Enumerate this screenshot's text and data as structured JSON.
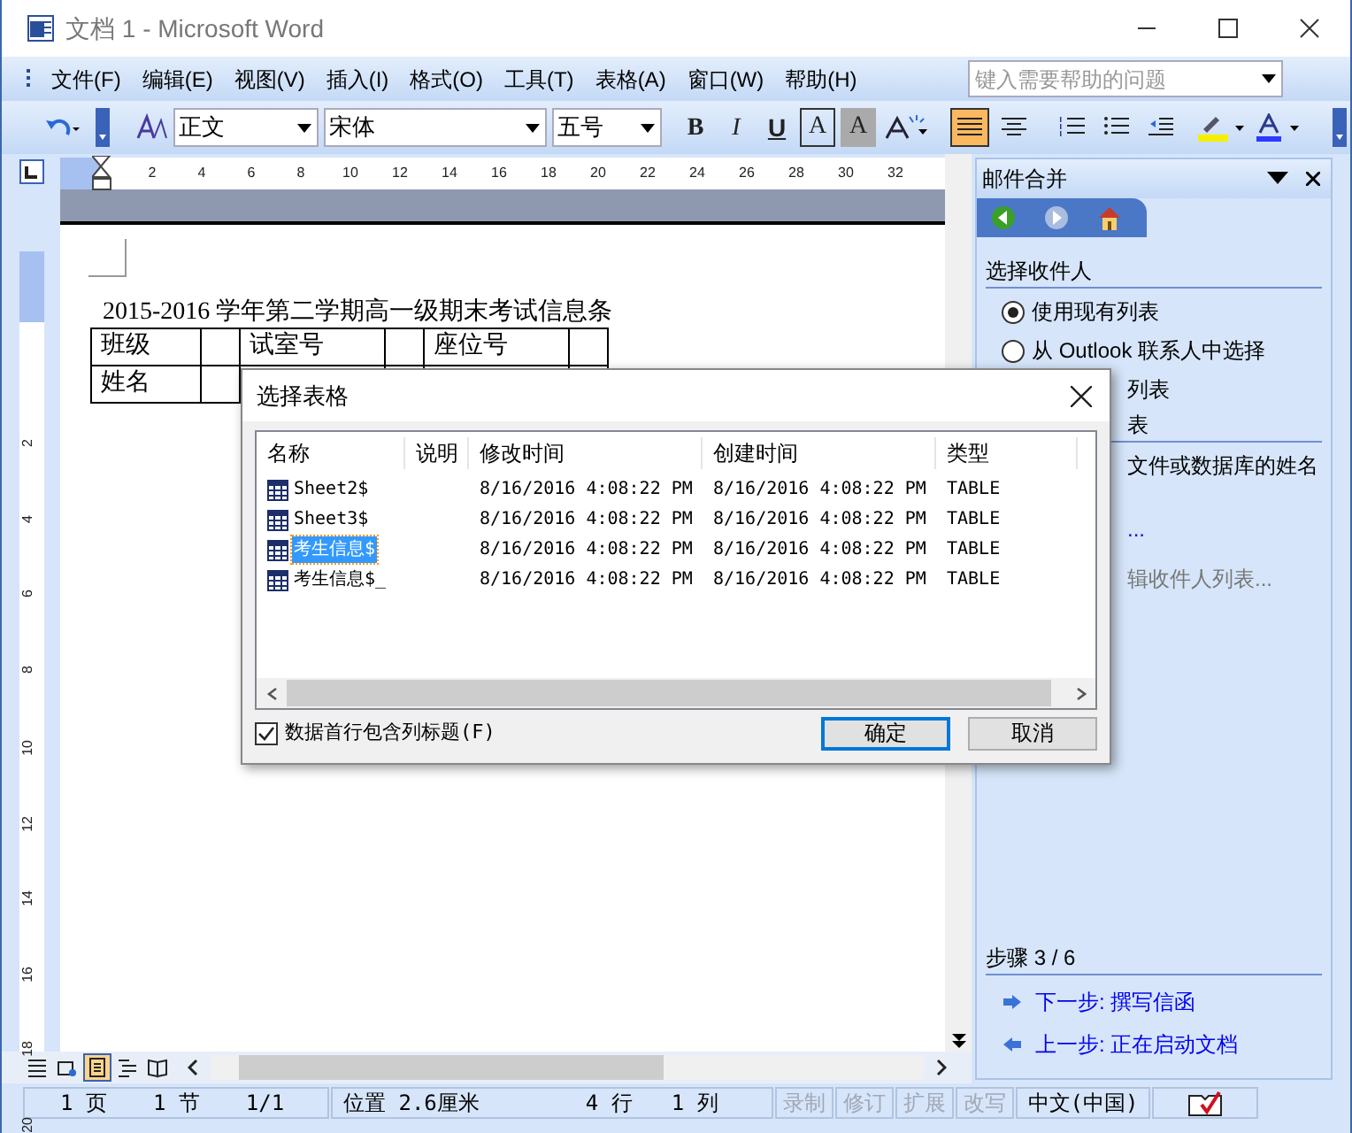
{
  "window": {
    "title": "文档 1 - Microsoft Word"
  },
  "menu": [
    {
      "label": "文件(F)"
    },
    {
      "label": "编辑(E)"
    },
    {
      "label": "视图(V)"
    },
    {
      "label": "插入(I)"
    },
    {
      "label": "格式(O)"
    },
    {
      "label": "工具(T)"
    },
    {
      "label": "表格(A)"
    },
    {
      "label": "窗口(W)"
    },
    {
      "label": "帮助(H)"
    }
  ],
  "help_box": {
    "placeholder": "键入需要帮助的问题"
  },
  "toolbar": {
    "style": "正文",
    "font": "宋体",
    "size": "五号",
    "format_buttons": [
      {
        "label": "B",
        "kind": "bold"
      },
      {
        "label": "I",
        "kind": "italic"
      },
      {
        "label": "U",
        "kind": "underline"
      },
      {
        "label": "A",
        "kind": "border"
      },
      {
        "label": "A",
        "kind": "shade"
      }
    ],
    "align_buttons": [
      {
        "kind": "justify",
        "selected": true
      },
      {
        "kind": "center",
        "selected": false
      }
    ]
  },
  "ruler": {
    "ticks": [
      "2",
      "4",
      "6",
      "8",
      "10",
      "12",
      "14",
      "16",
      "18",
      "20",
      "22",
      "24",
      "26",
      "28",
      "30",
      "32"
    ]
  },
  "vertical_ruler": {
    "ticks": [
      "2",
      "4",
      "6",
      "8",
      "10",
      "12",
      "14",
      "16",
      "18",
      "20"
    ]
  },
  "document": {
    "heading": "2015-2016 学年第二学期高一级期末考试信息条",
    "table": [
      {
        "column_1": "班级",
        "column_3": "试室号",
        "column_5": "座位号"
      },
      {
        "column_1": "姓名"
      }
    ]
  },
  "task_pane": {
    "title": "邮件合并",
    "section": "选择收件人",
    "options": [
      {
        "label": "使用现有列表",
        "selected": true
      },
      {
        "label": "从 Outlook 联系人中选择",
        "selected": false
      }
    ],
    "fragments": [
      {
        "kind": "text",
        "text": "列表"
      },
      {
        "kind": "heading",
        "text": "表"
      },
      {
        "kind": "text",
        "text": "文件或数据库的姓名"
      },
      {
        "kind": "link",
        "text": "..."
      },
      {
        "kind": "muted",
        "text": "辑收件人列表..."
      }
    ],
    "step": "步骤 3 / 6",
    "next": "下一步: 撰写信函",
    "previous": "上一步: 正在启动文档"
  },
  "view_buttons": [
    {
      "selected": false
    },
    {
      "selected": false
    },
    {
      "selected": true
    },
    {
      "selected": false
    },
    {
      "selected": false
    }
  ],
  "status_bar": [
    {
      "text": "1 页",
      "disabled": false
    },
    {
      "text": "1 节",
      "disabled": false
    },
    {
      "text": "1/1",
      "disabled": false
    },
    {
      "text": "位置 2.6厘米",
      "disabled": false
    },
    {
      "text": "4 行",
      "disabled": false
    },
    {
      "text": "1 列",
      "disabled": false
    },
    {
      "text": "录制",
      "disabled": true
    },
    {
      "text": "修订",
      "disabled": true
    },
    {
      "text": "扩展",
      "disabled": true
    },
    {
      "text": "改写",
      "disabled": true
    },
    {
      "text": "中文(中国)",
      "disabled": false
    }
  ],
  "dialog": {
    "title": "选择表格",
    "columns": [
      "名称",
      "说明",
      "修改时间",
      "创建时间",
      "类型"
    ],
    "rows": [
      {
        "name": "Sheet2$",
        "modified": "8/16/2016 4:08:22 PM",
        "created": "8/16/2016 4:08:22 PM",
        "type": "TABLE",
        "selected": false
      },
      {
        "name": "Sheet3$",
        "modified": "8/16/2016 4:08:22 PM",
        "created": "8/16/2016 4:08:22 PM",
        "type": "TABLE",
        "selected": false
      },
      {
        "name": "考生信息$",
        "modified": "8/16/2016 4:08:22 PM",
        "created": "8/16/2016 4:08:22 PM",
        "type": "TABLE",
        "selected": true
      },
      {
        "name": "考生信息$_",
        "modified": "8/16/2016 4:08:22 PM",
        "created": "8/16/2016 4:08:22 PM",
        "type": "TABLE",
        "selected": false
      }
    ],
    "checkbox": {
      "label": "数据首行包含列标题(F)",
      "checked": true
    },
    "ok": "确定",
    "cancel": "取消"
  }
}
